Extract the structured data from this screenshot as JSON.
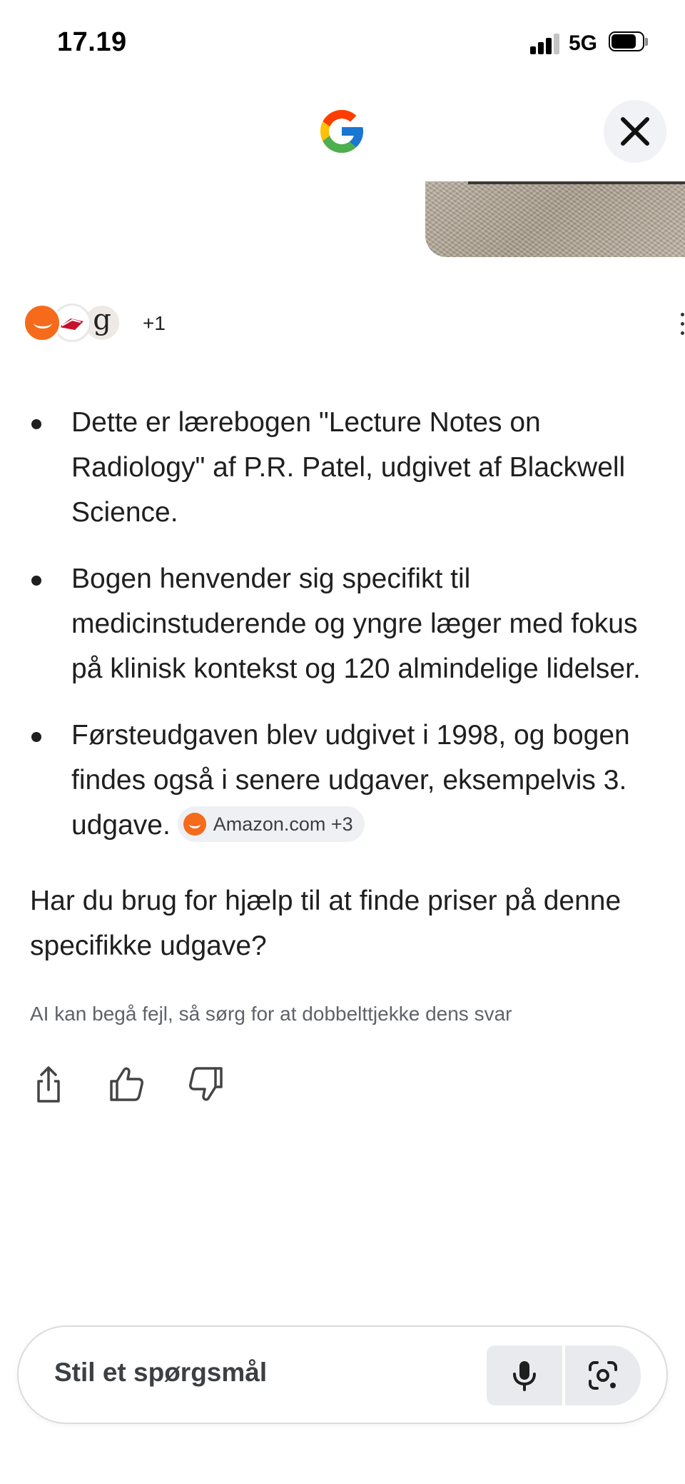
{
  "status_bar": {
    "time": "17.19",
    "network": "5G"
  },
  "header": {
    "logo_icon": "google-g-icon",
    "close_icon": "close-icon"
  },
  "sources": {
    "icons": [
      "amazon-icon",
      "book-cover-icon",
      "goodreads-icon"
    ],
    "goodreads_letter": "g",
    "more_count": "+1"
  },
  "answer": {
    "bullets": [
      {
        "lines": [
          "Dette er lærebogen \"Lecture Notes on",
          "Radiology\" af P.R. Patel, udgivet af Blackwell",
          "Science."
        ]
      },
      {
        "lines": [
          "Bogen henvender sig specifikt til",
          "medicinstuderende og yngre læger med fokus",
          "på klinisk kontekst og 120 almindelige lidelser."
        ]
      },
      {
        "lines": [
          "Førsteudgaven blev udgivet i 1998, og bogen",
          "findes også i senere udgaver, eksempelvis 3.",
          "udgave."
        ],
        "citation": "Amazon.com +3"
      }
    ],
    "followup_lines": [
      "Har du brug for hjælp til at finde priser på denne",
      "specifikke udgave?"
    ],
    "disclaimer": "AI kan begå fejl, så sørg for at dobbelttjekke dens svar"
  },
  "actions": [
    "share-icon",
    "thumbs-up-icon",
    "thumbs-down-icon"
  ],
  "input": {
    "placeholder": "Stil et spørgsmål",
    "mic_icon": "microphone-icon",
    "lens_icon": "camera-lens-icon"
  },
  "colors": {
    "amazon_orange": "#f56b1b",
    "chip_background": "#eef0f3",
    "text": "#1f1f1f",
    "muted_text": "#5f6368"
  }
}
